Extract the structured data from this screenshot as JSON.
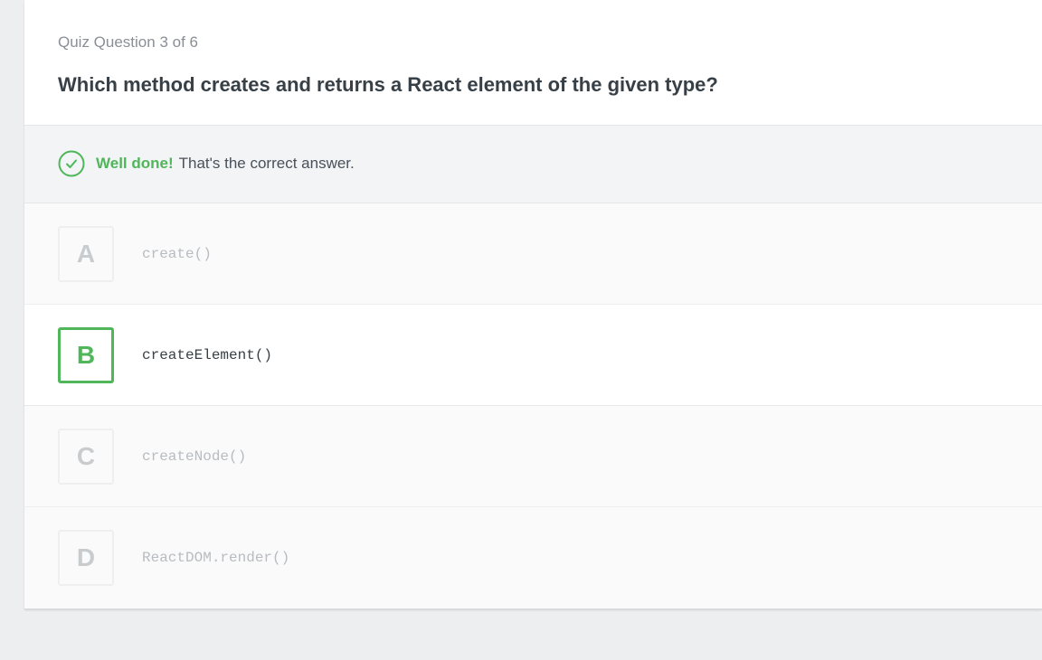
{
  "quiz": {
    "progress": "Quiz Question 3 of 6",
    "question": "Which method creates and returns a React element of the given type?"
  },
  "feedback": {
    "icon": "check-circle-icon",
    "strong": "Well done!",
    "text": "That's the correct answer.",
    "color": "#4fb659"
  },
  "options": [
    {
      "letter": "A",
      "code": "create()",
      "selected": false
    },
    {
      "letter": "B",
      "code": "createElement()",
      "selected": true
    },
    {
      "letter": "C",
      "code": "createNode()",
      "selected": false
    },
    {
      "letter": "D",
      "code": "ReactDOM.render()",
      "selected": false
    }
  ]
}
